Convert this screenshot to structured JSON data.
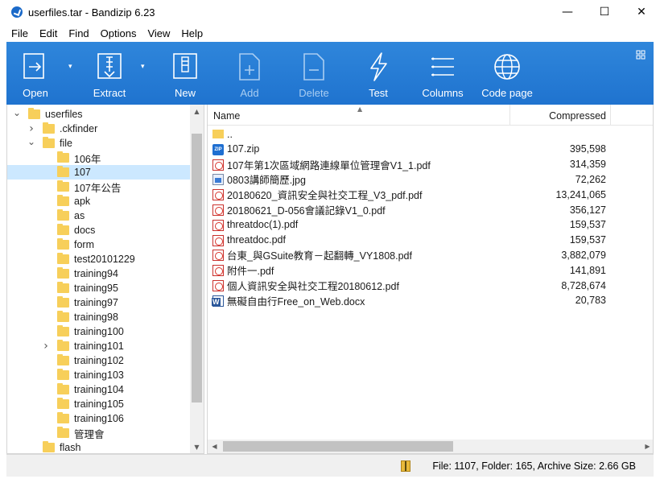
{
  "window": {
    "title": "userfiles.tar - Bandizip 6.23",
    "minimize": "—",
    "maximize": "☐",
    "close": "✕"
  },
  "menu": [
    "File",
    "Edit",
    "Find",
    "Options",
    "View",
    "Help"
  ],
  "toolbar": {
    "open": "Open",
    "extract": "Extract",
    "new": "New",
    "add": "Add",
    "delete": "Delete",
    "test": "Test",
    "columns": "Columns",
    "codepage": "Code page"
  },
  "tree": [
    {
      "label": "userfiles",
      "level": 0,
      "expander": "open"
    },
    {
      "label": ".ckfinder",
      "level": 1,
      "expander": "closed"
    },
    {
      "label": "file",
      "level": 1,
      "expander": "open"
    },
    {
      "label": "106年",
      "level": 2,
      "expander": ""
    },
    {
      "label": "107",
      "level": 2,
      "expander": "",
      "selected": true
    },
    {
      "label": "107年公告",
      "level": 2,
      "expander": ""
    },
    {
      "label": "apk",
      "level": 2,
      "expander": ""
    },
    {
      "label": "as",
      "level": 2,
      "expander": ""
    },
    {
      "label": "docs",
      "level": 2,
      "expander": ""
    },
    {
      "label": "form",
      "level": 2,
      "expander": ""
    },
    {
      "label": "test20101229",
      "level": 2,
      "expander": ""
    },
    {
      "label": "training94",
      "level": 2,
      "expander": ""
    },
    {
      "label": "training95",
      "level": 2,
      "expander": ""
    },
    {
      "label": "training97",
      "level": 2,
      "expander": ""
    },
    {
      "label": "training98",
      "level": 2,
      "expander": ""
    },
    {
      "label": "training100",
      "level": 2,
      "expander": ""
    },
    {
      "label": "training101",
      "level": 2,
      "expander": "closed"
    },
    {
      "label": "training102",
      "level": 2,
      "expander": ""
    },
    {
      "label": "training103",
      "level": 2,
      "expander": ""
    },
    {
      "label": "training104",
      "level": 2,
      "expander": ""
    },
    {
      "label": "training105",
      "level": 2,
      "expander": ""
    },
    {
      "label": "training106",
      "level": 2,
      "expander": ""
    },
    {
      "label": "管理會",
      "level": 2,
      "expander": ""
    },
    {
      "label": "flash",
      "level": 1,
      "expander": ""
    }
  ],
  "list": {
    "col_name": "Name",
    "col_compressed": "Compressed",
    "rows": [
      {
        "icon": "folder",
        "name": "..",
        "size": ""
      },
      {
        "icon": "zip",
        "name": "107.zip",
        "size": "395,598"
      },
      {
        "icon": "pdf",
        "name": "107年第1次區域網路連線單位管理會V1_1.pdf",
        "size": "314,359"
      },
      {
        "icon": "jpg",
        "name": "0803講師簡歷.jpg",
        "size": "72,262"
      },
      {
        "icon": "pdf",
        "name": "20180620_資訊安全與社交工程_V3_pdf.pdf",
        "size": "13,241,065"
      },
      {
        "icon": "pdf",
        "name": "20180621_D-056會議記錄V1_0.pdf",
        "size": "356,127"
      },
      {
        "icon": "pdf",
        "name": "threatdoc(1).pdf",
        "size": "159,537"
      },
      {
        "icon": "pdf",
        "name": "threatdoc.pdf",
        "size": "159,537"
      },
      {
        "icon": "pdf",
        "name": "台東_與GSuite教育－起翻轉_VY1808.pdf",
        "size": "3,882,079"
      },
      {
        "icon": "pdf",
        "name": "附件一.pdf",
        "size": "141,891"
      },
      {
        "icon": "pdf",
        "name": "個人資訊安全與社交工程20180612.pdf",
        "size": "8,728,674"
      },
      {
        "icon": "docx",
        "name": "無礙自由行Free_on_Web.docx",
        "size": "20,783"
      }
    ]
  },
  "status": {
    "text": "File: 1107, Folder: 165, Archive Size: 2.66 GB"
  },
  "colors": {
    "toolbar_top": "#2f86db",
    "toolbar_bottom": "#1f73cf",
    "selection": "#cce8ff",
    "folder": "#f7cf5a"
  }
}
